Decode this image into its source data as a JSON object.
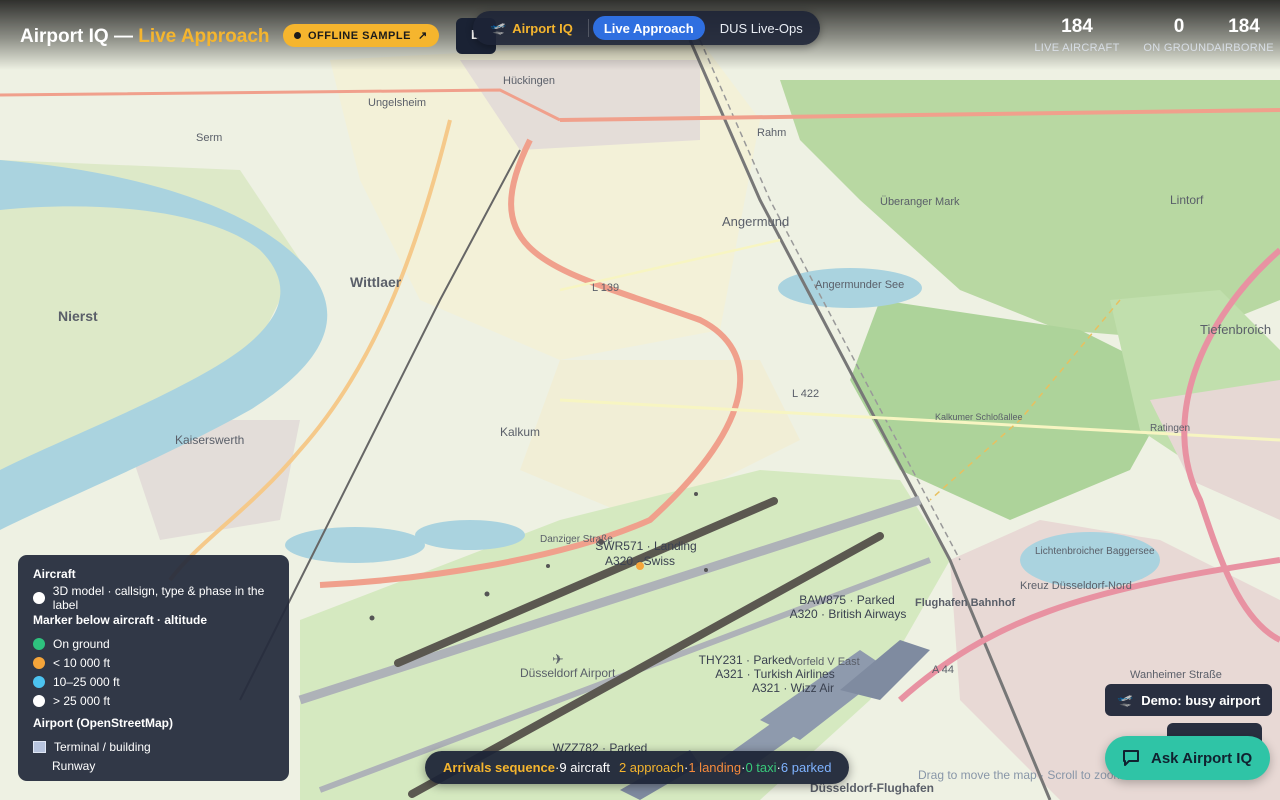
{
  "header": {
    "title_prefix": "Airport IQ — ",
    "title_accent": "Live Approach",
    "badge": "OFFLINE SAMPLE",
    "badge_icon": "↗",
    "chip": "L"
  },
  "nav": {
    "brand": "Airport IQ",
    "tabs": [
      "Live Approach",
      "DUS Live-Ops"
    ],
    "active": "Live Approach"
  },
  "stats": [
    {
      "value": "184",
      "label": "LIVE AIRCRAFT"
    },
    {
      "value": "0",
      "label": "ON GROUND"
    },
    {
      "value": "184",
      "label": "AIRBORNE"
    }
  ],
  "legend": {
    "aircraft_heading": "Aircraft",
    "model_note": "3D model · callsign, type & phase in the label",
    "marker_heading": "Marker below aircraft · altitude",
    "markers": [
      {
        "label": "On ground",
        "color": "#2ec27e"
      },
      {
        "label": "< 10 000 ft",
        "color": "#f5a53a"
      },
      {
        "label": "10–25 000 ft",
        "color": "#4cc3f0"
      },
      {
        "label": "> 25 000 ft",
        "color": "#ffffff"
      }
    ],
    "airport_heading": "Airport (OpenStreetMap)",
    "terminal": "Terminal / building",
    "runway": "Runway"
  },
  "sequence": {
    "title": "Arrivals sequence",
    "aircraft": "9 aircraft",
    "approach": "2 approach",
    "landing": "1 landing",
    "taxi": "0 taxi",
    "parked": "6 parked",
    "sep": " · "
  },
  "buttons": {
    "demo": "Demo: busy airport",
    "ask": "Ask Airport IQ"
  },
  "hint": "Drag to move the map · Scroll to zoom",
  "map": {
    "places": [
      "Wittlaer",
      "Nierst",
      "Kaiserswerth",
      "Kalkum",
      "Angermund",
      "Tiefenbroich",
      "Lintorf",
      "Ratingen",
      "Lichtenbroicher Baggersee",
      "Angermunder See",
      "Überanger Mark",
      "Düsseldorf Airport",
      "Flughafen Bahnhof",
      "Düsseldorf-Flughafen",
      "Vorfeld V East",
      "Hückingen",
      "Ungelsheim",
      "Serm",
      "Rahm"
    ],
    "roads": [
      "L 139",
      "L 422",
      "Danziger Straße",
      "Kreuz Düsseldorf-Nord",
      "A 44",
      "Wanheimer Straße",
      "Kalkumer Schloßallee"
    ]
  },
  "aircraft_labels": [
    {
      "callsign": "SWR571",
      "phase": "Landing",
      "type": "A320",
      "airline": "Swiss"
    },
    {
      "callsign": "BAW875",
      "phase": "Parked",
      "type": "A320",
      "airline": "British Airways"
    },
    {
      "callsign": "THY231",
      "phase": "Parked",
      "type": "A321",
      "airline": "Turkish Airlines"
    },
    {
      "callsign": "WZZ7",
      "phase": "Parked",
      "type": "A321",
      "airline": "Wizz Air"
    },
    {
      "callsign": "WZZ782",
      "phase": "Parked",
      "type": "",
      "airline": ""
    }
  ],
  "colors": {
    "accent": "#f5b52e",
    "active_tab": "#2f6fe0",
    "ask_button": "#2fc4a6",
    "panel": "#252c3d"
  }
}
